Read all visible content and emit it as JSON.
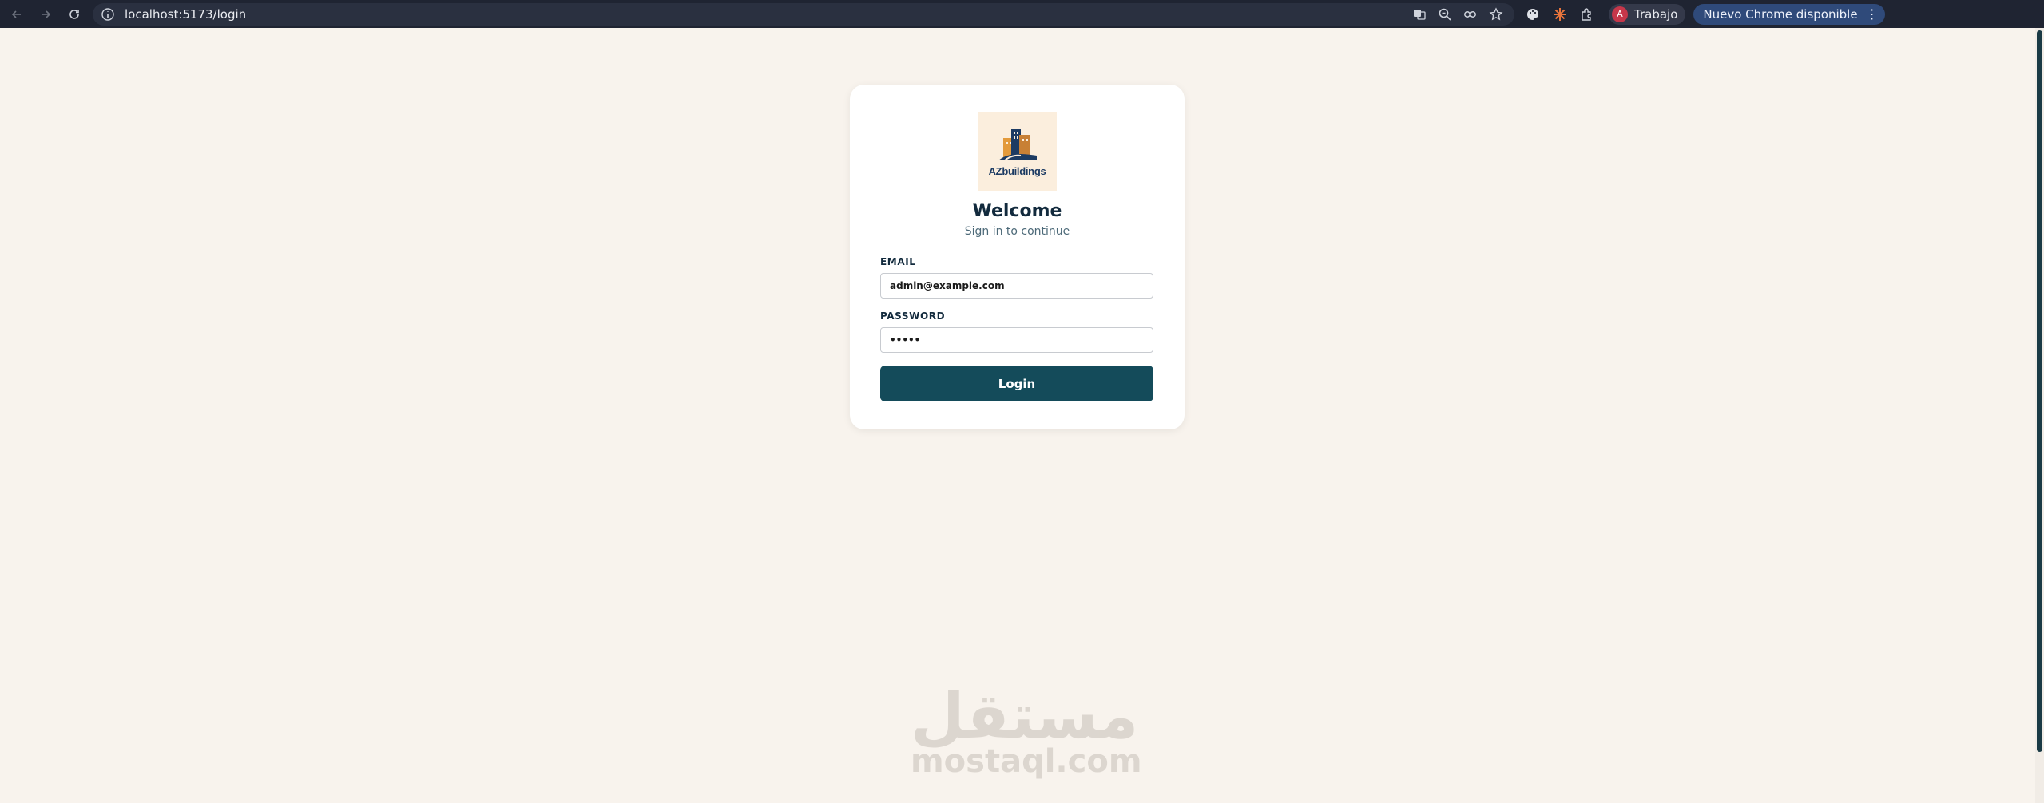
{
  "browser": {
    "url": "localhost:5173/login",
    "profile_initial": "A",
    "profile_name": "Trabajo",
    "update_label": "Nuevo Chrome disponible",
    "menu_icon": "⋮"
  },
  "login": {
    "logo_text": "AZbuildings",
    "title": "Welcome",
    "subtitle": "Sign in to continue",
    "email_label": "EMAIL",
    "email_value": "admin@example.com",
    "password_label": "PASSWORD",
    "password_value": "•••••",
    "button_label": "Login"
  },
  "watermark": {
    "arabic": "مستقل",
    "latin": "mostaql.com"
  },
  "colors": {
    "page_bg": "#f8f3ed",
    "chrome_bg": "#1f2432",
    "primary_button": "#144b5a",
    "heading": "#122a3d"
  }
}
